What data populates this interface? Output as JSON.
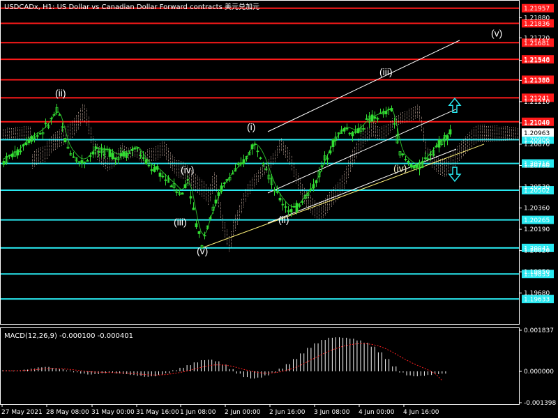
{
  "window": {
    "title": "USDCADx, H1: US Dollar vs Canadian Dollar Forward contracts 美元兑加元"
  },
  "colors": {
    "background": "#000000",
    "grid_text": "#ffffff",
    "candle": "#33dd33",
    "resistance": "#ff1a1a",
    "support": "#28e8f0",
    "channel": "#ffffff",
    "channel_lower": "#fff27a",
    "ma_red": "#ff2020",
    "ma_blue": "#3050ff",
    "ichimoku_cloud": "#f0d0c0",
    "macd_hist": "#ffffff",
    "macd_signal": "#ff2020",
    "arrow": "#28e8f0"
  },
  "chart_data": [
    {
      "type": "candlestick",
      "title": "USDCADx, H1: US Dollar vs Canadian Dollar Forward contracts 美元兑加元",
      "ylim": [
        1.1945,
        1.22
      ],
      "y_ticks": [
        "1.21880",
        "1.21720",
        "1.21540",
        "1.21380",
        "1.21210",
        "1.21040",
        "1.20870",
        "1.20700",
        "1.20530",
        "1.20360",
        "1.20190",
        "1.20020",
        "1.19850",
        "1.19680"
      ],
      "x_ticks": [
        "27 May 2021",
        "28 May 08:00",
        "31 May 00:00",
        "31 May 16:00",
        "1 Jun 08:00",
        "2 Jun 00:00",
        "2 Jun 16:00",
        "3 Jun 08:00",
        "4 Jun 00:00",
        "4 Jun 16:00"
      ],
      "current_price": "1.20963",
      "price_series": [
        [
          0,
          1.2073
        ],
        [
          10,
          1.2078
        ],
        [
          20,
          1.208
        ],
        [
          30,
          1.2088
        ],
        [
          40,
          1.2092
        ],
        [
          50,
          1.2095
        ],
        [
          60,
          1.21
        ],
        [
          70,
          1.2108
        ],
        [
          75,
          1.2114
        ],
        [
          80,
          1.2109
        ],
        [
          85,
          1.2098
        ],
        [
          90,
          1.2085
        ],
        [
          100,
          1.2078
        ],
        [
          110,
          1.2072
        ],
        [
          120,
          1.2075
        ],
        [
          130,
          1.2083
        ],
        [
          140,
          1.208
        ],
        [
          150,
          1.2082
        ],
        [
          160,
          1.2076
        ],
        [
          170,
          1.2079
        ],
        [
          180,
          1.208
        ],
        [
          190,
          1.2085
        ],
        [
          200,
          1.2075
        ],
        [
          210,
          1.2068
        ],
        [
          220,
          1.2066
        ],
        [
          230,
          1.206
        ],
        [
          240,
          1.2055
        ],
        [
          250,
          1.205
        ],
        [
          255,
          1.2045
        ],
        [
          260,
          1.2055
        ],
        [
          265,
          1.206
        ],
        [
          270,
          1.204
        ],
        [
          275,
          1.2025
        ],
        [
          280,
          1.2015
        ],
        [
          285,
          1.2006
        ],
        [
          290,
          1.202
        ],
        [
          300,
          1.2035
        ],
        [
          310,
          1.205
        ],
        [
          320,
          1.2058
        ],
        [
          330,
          1.2065
        ],
        [
          340,
          1.207
        ],
        [
          350,
          1.2078
        ],
        [
          358,
          1.2088
        ],
        [
          365,
          1.2082
        ],
        [
          372,
          1.2076
        ],
        [
          380,
          1.2062
        ],
        [
          390,
          1.2048
        ],
        [
          400,
          1.204
        ],
        [
          410,
          1.2034
        ],
        [
          420,
          1.2036
        ],
        [
          430,
          1.2044
        ],
        [
          440,
          1.205
        ],
        [
          450,
          1.206
        ],
        [
          460,
          1.2075
        ],
        [
          470,
          1.2086
        ],
        [
          480,
          1.2095
        ],
        [
          490,
          1.21
        ],
        [
          500,
          1.2096
        ],
        [
          510,
          1.2098
        ],
        [
          520,
          1.2105
        ],
        [
          530,
          1.2108
        ],
        [
          540,
          1.211
        ],
        [
          548,
          1.2112
        ],
        [
          556,
          1.2115
        ],
        [
          562,
          1.2098
        ],
        [
          568,
          1.208
        ],
        [
          575,
          1.2075
        ],
        [
          585,
          1.207
        ],
        [
          595,
          1.2068
        ],
        [
          605,
          1.2075
        ],
        [
          615,
          1.2082
        ],
        [
          625,
          1.2088
        ],
        [
          635,
          1.2094
        ],
        [
          640,
          1.2096
        ]
      ],
      "resistance_levels": [
        "1.21957",
        "1.21836",
        "1.21681",
        "1.21548",
        "1.21385",
        "1.21241",
        "1.21049"
      ],
      "support_levels": [
        "1.20906",
        "1.20716",
        "1.20502",
        "1.20265",
        "1.20041",
        "1.19833",
        "1.19633"
      ],
      "wave_labels": [
        "(ii)",
        "(iii)",
        "(iv)",
        "(v)",
        "(i)",
        "(ii)",
        "(iii)",
        "(iv)",
        "(v)"
      ]
    },
    {
      "type": "bar",
      "title": "MACD(12,26,9) -0.000100 -0.000401",
      "ylim": [
        -0.001398,
        0.001837
      ],
      "y_ticks": [
        "0.001837",
        "0.000000",
        "-0.001398"
      ],
      "series": [
        {
          "name": "MACD",
          "values": [
            5e-05,
            3e-05,
            2e-05,
            8e-05,
            0.00012,
            0.00018,
            0.0002,
            0.00015,
            0.0001,
            4e-05,
            -4e-05,
            -0.0001,
            -0.00014,
            -0.00012,
            -8e-05,
            -6e-05,
            -9e-05,
            -0.00012,
            -0.00016,
            -0.0002,
            -0.00024,
            -0.00022,
            -0.00016,
            -8e-05,
            5e-05,
            0.00016,
            0.00028,
            0.0004,
            0.0005,
            0.00052,
            0.00045,
            0.0003,
            0.0001,
            -0.0001,
            -0.00025,
            -0.00032,
            -0.00028,
            -0.00018,
            -5e-05,
            0.00012,
            0.00032,
            0.00055,
            0.0008,
            0.00105,
            0.00125,
            0.0014,
            0.0015,
            0.00152,
            0.0015,
            0.00146,
            0.00138,
            0.00128,
            0.0011,
            0.00085,
            0.00055,
            0.00022,
            -5e-05,
            -0.00018,
            -0.00022,
            -0.0002,
            -0.00016,
            -0.00012,
            -0.0001
          ]
        },
        {
          "name": "Signal",
          "values": [
            2e-05,
            3e-05,
            3e-05,
            4e-05,
            6e-05,
            9e-05,
            0.00012,
            0.00013,
            0.00012,
            0.0001,
            7e-05,
            3e-05,
            -1e-05,
            -3e-05,
            -4e-05,
            -5e-05,
            -6e-05,
            -7e-05,
            -9e-05,
            -0.00011,
            -0.00014,
            -0.00016,
            -0.00016,
            -0.00014,
            -0.0001,
            -5e-05,
            2e-05,
            0.0001,
            0.00018,
            0.00025,
            0.00029,
            0.00029,
            0.00025,
            0.00018,
            9e-05,
            1e-05,
            -5e-05,
            -8e-05,
            -7e-05,
            -3e-05,
            4e-05,
            0.00014,
            0.00027,
            0.00043,
            0.00059,
            0.00075,
            0.0009,
            0.00102,
            0.00112,
            0.00119,
            0.00123,
            0.00124,
            0.00121,
            0.00114,
            0.00102,
            0.00086,
            0.00068,
            0.0005,
            0.00034,
            0.0002,
            7e-05,
            -0.0001,
            -0.0004
          ]
        }
      ]
    }
  ]
}
